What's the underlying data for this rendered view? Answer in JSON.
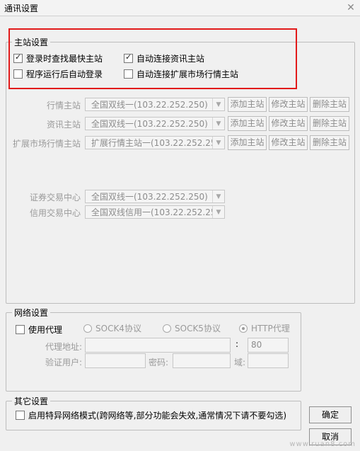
{
  "window": {
    "title": "通讯设置",
    "close_glyph": "✕"
  },
  "main_station": {
    "group_title": "主站设置",
    "highlight_color": "#e21a1a",
    "options": [
      {
        "label": "登录时查找最快主站",
        "checked": true
      },
      {
        "label": "自动连接资讯主站",
        "checked": true
      },
      {
        "label": "程序运行后自动登录",
        "checked": false
      },
      {
        "label": "自动连接扩展市场行情主站",
        "checked": false
      }
    ],
    "rows": [
      {
        "label": "行情主站",
        "value": "全国双线一(103.22.252.250)"
      },
      {
        "label": "资讯主站",
        "value": "全国双线一(103.22.252.250)"
      },
      {
        "label": "扩展市场行情主站",
        "value": "扩展行情主站一(103.22.252.25"
      }
    ],
    "buttons": {
      "add": "添加主站",
      "edit": "修改主站",
      "delete": "删除主站"
    },
    "trade_rows": [
      {
        "label": "证券交易中心",
        "value": "全国双线一(103.22.252.250)"
      },
      {
        "label": "信用交易中心",
        "value": "全国双线信用一(103.22.252.25"
      }
    ]
  },
  "network": {
    "group_title": "网络设置",
    "use_proxy": {
      "label": "使用代理",
      "checked": false
    },
    "protocols": [
      {
        "label": "SOCK4协议",
        "selected": false
      },
      {
        "label": "SOCK5协议",
        "selected": false
      },
      {
        "label": "HTTP代理",
        "selected": true
      }
    ],
    "proxy_address_label": "代理地址:",
    "port_separator": ":",
    "port_value": "80",
    "auth_user_label": "验证用户:",
    "password_label": "密码:",
    "domain_label": "域:"
  },
  "other": {
    "group_title": "其它设置",
    "special_network": {
      "label": "启用特异网络模式(跨网络等,部分功能会失效,通常情况下请不要勾选)",
      "checked": false
    }
  },
  "footer": {
    "ok_label": "确定",
    "cancel_label": "取消",
    "watermark": "www.ruan8.com"
  }
}
